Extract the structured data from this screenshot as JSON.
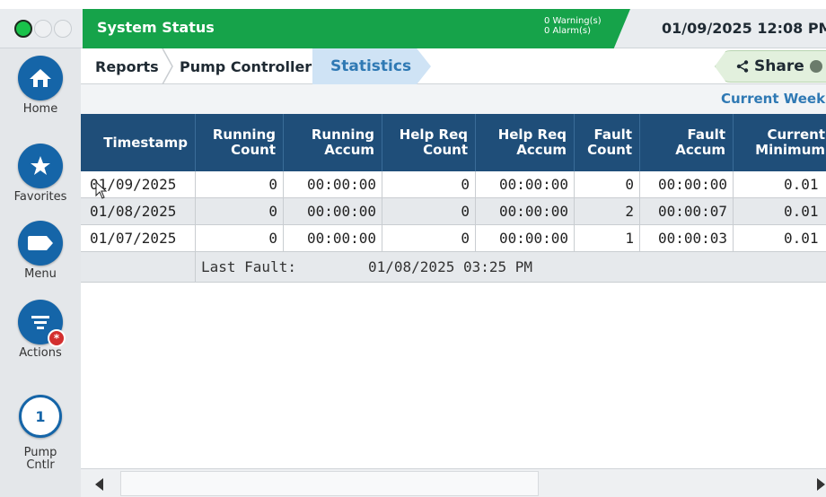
{
  "status_bar": {
    "title": "System Status",
    "warnings": "0 Warning(s)",
    "alarms": "0 Alarm(s)",
    "datetime": "01/09/2025 12:08 PM",
    "accent": "#16a34a"
  },
  "sidebar": {
    "items": [
      {
        "label": "Home",
        "icon": "home-icon"
      },
      {
        "label": "Favorites",
        "icon": "star-icon"
      },
      {
        "label": "Menu",
        "icon": "menu-icon"
      },
      {
        "label": "Actions",
        "icon": "actions-icon",
        "badge": "*"
      },
      {
        "label": "Pump\nCntlr",
        "icon": "pump-number-icon",
        "number": "1"
      }
    ]
  },
  "breadcrumb": {
    "items": [
      "Reports",
      "Pump Controller",
      "Statistics"
    ],
    "share_label": "Share"
  },
  "period": {
    "label": "Current Week"
  },
  "table": {
    "headers": [
      "Timestamp",
      "Running Count",
      "Running Accum",
      "Help Req Count",
      "Help Req Accum",
      "Fault Count",
      "Fault Accum",
      "Current Minimum"
    ],
    "rows": [
      [
        "01/09/2025",
        "0",
        "00:00:00",
        "0",
        "00:00:00",
        "0",
        "00:00:00",
        "0.01"
      ],
      [
        "01/08/2025",
        "0",
        "00:00:00",
        "0",
        "00:00:00",
        "2",
        "00:00:07",
        "0.01"
      ],
      [
        "01/07/2025",
        "0",
        "00:00:00",
        "0",
        "00:00:00",
        "1",
        "00:00:03",
        "0.01"
      ]
    ],
    "last_fault_label": "Last Fault:",
    "last_fault_value": "01/08/2025 03:25 PM",
    "header_color": "#1f4e79"
  }
}
